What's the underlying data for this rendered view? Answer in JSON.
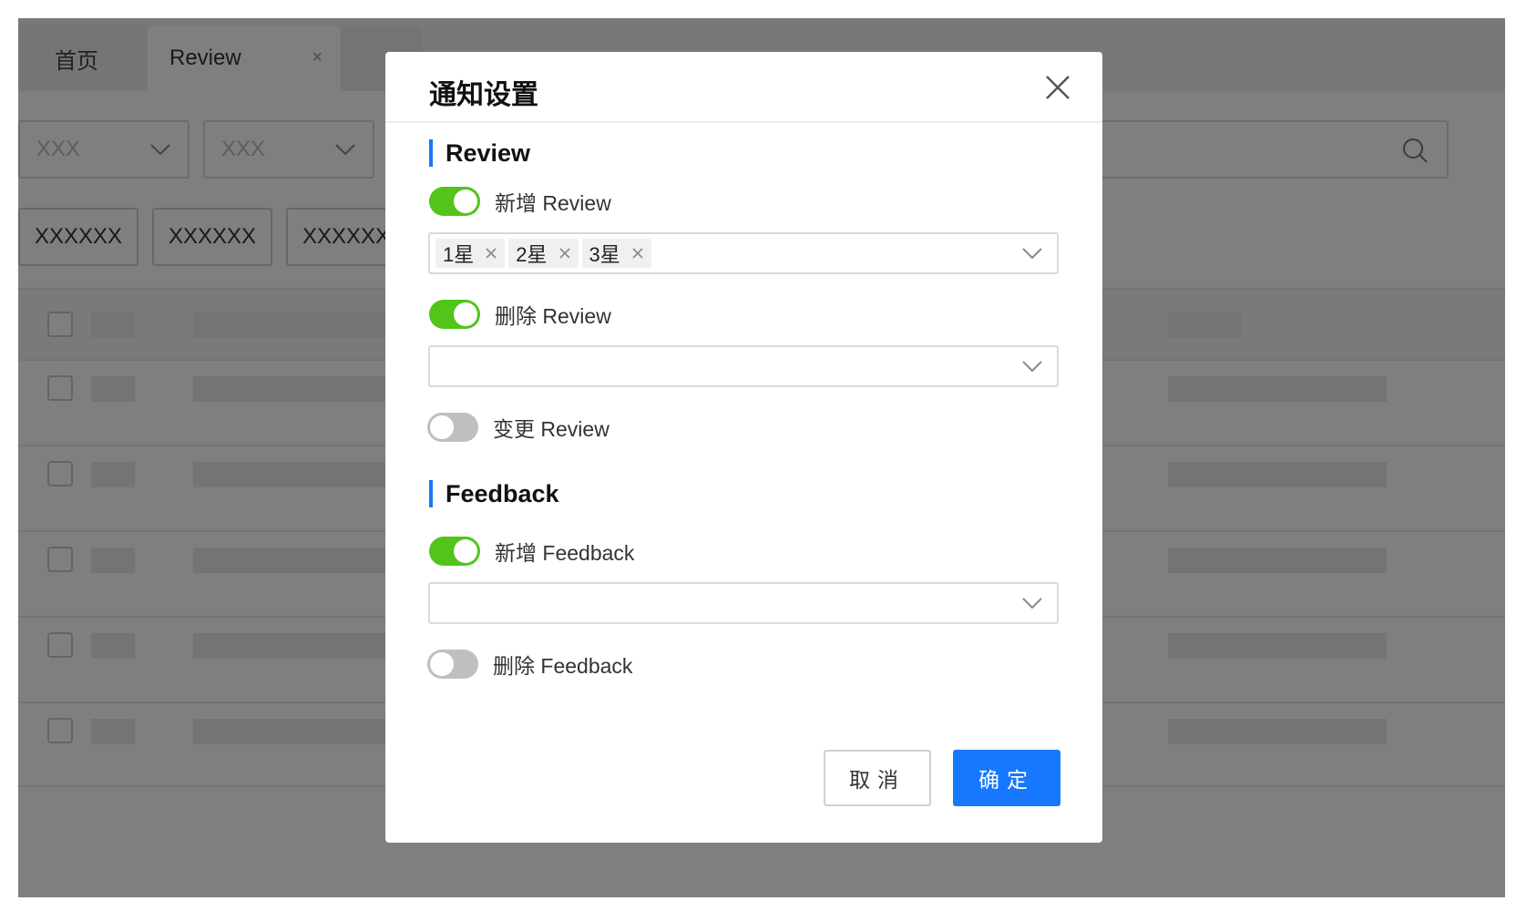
{
  "background": {
    "tabs": [
      {
        "label": "首页"
      },
      {
        "label": "Review",
        "close": "×"
      }
    ],
    "filters": [
      {
        "value": "XXX"
      },
      {
        "value": "XXX"
      }
    ],
    "buttons": [
      {
        "label": "XXXXXX"
      },
      {
        "label": "XXXXXX"
      },
      {
        "label": "XXXXXX"
      }
    ]
  },
  "modal": {
    "title": "通知设置",
    "sections": [
      {
        "title": "Review"
      },
      {
        "title": "Feedback"
      }
    ],
    "switches": [
      {
        "label": "新增 Review",
        "on": true
      },
      {
        "label": "删除 Review",
        "on": true
      },
      {
        "label": "变更 Review",
        "on": false
      },
      {
        "label": "新增 Feedback",
        "on": true
      },
      {
        "label": "删除 Feedback",
        "on": false
      }
    ],
    "selects": [
      {
        "tags": [
          "1星",
          "2星",
          "3星"
        ]
      },
      {
        "tags": []
      },
      {
        "tags": []
      }
    ],
    "cancel_label": "取消",
    "ok_label": "确定"
  },
  "colors": {
    "primary": "#1677ff",
    "switch_on": "#52c41a",
    "switch_off": "#bfbfbf",
    "overlay": "rgba(0,0,0,0.5)"
  }
}
